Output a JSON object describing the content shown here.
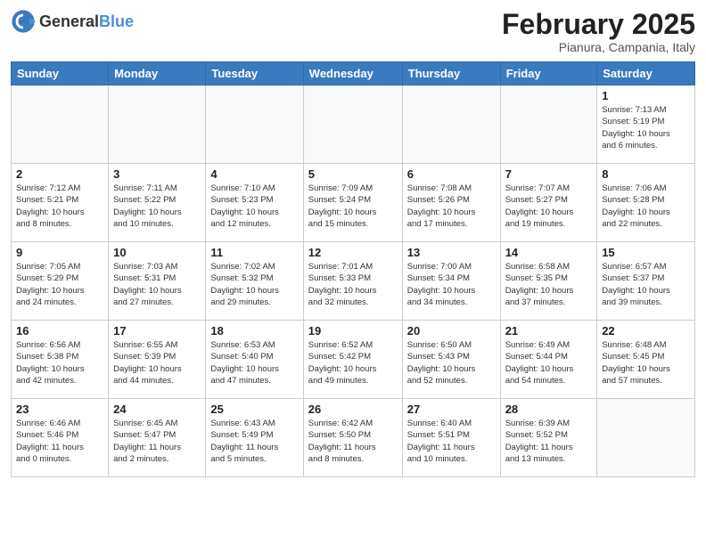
{
  "header": {
    "logo_general": "General",
    "logo_blue": "Blue",
    "month_title": "February 2025",
    "location": "Pianura, Campania, Italy"
  },
  "weekdays": [
    "Sunday",
    "Monday",
    "Tuesday",
    "Wednesday",
    "Thursday",
    "Friday",
    "Saturday"
  ],
  "weeks": [
    [
      {
        "day": "",
        "info": ""
      },
      {
        "day": "",
        "info": ""
      },
      {
        "day": "",
        "info": ""
      },
      {
        "day": "",
        "info": ""
      },
      {
        "day": "",
        "info": ""
      },
      {
        "day": "",
        "info": ""
      },
      {
        "day": "1",
        "info": "Sunrise: 7:13 AM\nSunset: 5:19 PM\nDaylight: 10 hours\nand 6 minutes."
      }
    ],
    [
      {
        "day": "2",
        "info": "Sunrise: 7:12 AM\nSunset: 5:21 PM\nDaylight: 10 hours\nand 8 minutes."
      },
      {
        "day": "3",
        "info": "Sunrise: 7:11 AM\nSunset: 5:22 PM\nDaylight: 10 hours\nand 10 minutes."
      },
      {
        "day": "4",
        "info": "Sunrise: 7:10 AM\nSunset: 5:23 PM\nDaylight: 10 hours\nand 12 minutes."
      },
      {
        "day": "5",
        "info": "Sunrise: 7:09 AM\nSunset: 5:24 PM\nDaylight: 10 hours\nand 15 minutes."
      },
      {
        "day": "6",
        "info": "Sunrise: 7:08 AM\nSunset: 5:26 PM\nDaylight: 10 hours\nand 17 minutes."
      },
      {
        "day": "7",
        "info": "Sunrise: 7:07 AM\nSunset: 5:27 PM\nDaylight: 10 hours\nand 19 minutes."
      },
      {
        "day": "8",
        "info": "Sunrise: 7:06 AM\nSunset: 5:28 PM\nDaylight: 10 hours\nand 22 minutes."
      }
    ],
    [
      {
        "day": "9",
        "info": "Sunrise: 7:05 AM\nSunset: 5:29 PM\nDaylight: 10 hours\nand 24 minutes."
      },
      {
        "day": "10",
        "info": "Sunrise: 7:03 AM\nSunset: 5:31 PM\nDaylight: 10 hours\nand 27 minutes."
      },
      {
        "day": "11",
        "info": "Sunrise: 7:02 AM\nSunset: 5:32 PM\nDaylight: 10 hours\nand 29 minutes."
      },
      {
        "day": "12",
        "info": "Sunrise: 7:01 AM\nSunset: 5:33 PM\nDaylight: 10 hours\nand 32 minutes."
      },
      {
        "day": "13",
        "info": "Sunrise: 7:00 AM\nSunset: 5:34 PM\nDaylight: 10 hours\nand 34 minutes."
      },
      {
        "day": "14",
        "info": "Sunrise: 6:58 AM\nSunset: 5:35 PM\nDaylight: 10 hours\nand 37 minutes."
      },
      {
        "day": "15",
        "info": "Sunrise: 6:57 AM\nSunset: 5:37 PM\nDaylight: 10 hours\nand 39 minutes."
      }
    ],
    [
      {
        "day": "16",
        "info": "Sunrise: 6:56 AM\nSunset: 5:38 PM\nDaylight: 10 hours\nand 42 minutes."
      },
      {
        "day": "17",
        "info": "Sunrise: 6:55 AM\nSunset: 5:39 PM\nDaylight: 10 hours\nand 44 minutes."
      },
      {
        "day": "18",
        "info": "Sunrise: 6:53 AM\nSunset: 5:40 PM\nDaylight: 10 hours\nand 47 minutes."
      },
      {
        "day": "19",
        "info": "Sunrise: 6:52 AM\nSunset: 5:42 PM\nDaylight: 10 hours\nand 49 minutes."
      },
      {
        "day": "20",
        "info": "Sunrise: 6:50 AM\nSunset: 5:43 PM\nDaylight: 10 hours\nand 52 minutes."
      },
      {
        "day": "21",
        "info": "Sunrise: 6:49 AM\nSunset: 5:44 PM\nDaylight: 10 hours\nand 54 minutes."
      },
      {
        "day": "22",
        "info": "Sunrise: 6:48 AM\nSunset: 5:45 PM\nDaylight: 10 hours\nand 57 minutes."
      }
    ],
    [
      {
        "day": "23",
        "info": "Sunrise: 6:46 AM\nSunset: 5:46 PM\nDaylight: 11 hours\nand 0 minutes."
      },
      {
        "day": "24",
        "info": "Sunrise: 6:45 AM\nSunset: 5:47 PM\nDaylight: 11 hours\nand 2 minutes."
      },
      {
        "day": "25",
        "info": "Sunrise: 6:43 AM\nSunset: 5:49 PM\nDaylight: 11 hours\nand 5 minutes."
      },
      {
        "day": "26",
        "info": "Sunrise: 6:42 AM\nSunset: 5:50 PM\nDaylight: 11 hours\nand 8 minutes."
      },
      {
        "day": "27",
        "info": "Sunrise: 6:40 AM\nSunset: 5:51 PM\nDaylight: 11 hours\nand 10 minutes."
      },
      {
        "day": "28",
        "info": "Sunrise: 6:39 AM\nSunset: 5:52 PM\nDaylight: 11 hours\nand 13 minutes."
      },
      {
        "day": "",
        "info": ""
      }
    ]
  ]
}
